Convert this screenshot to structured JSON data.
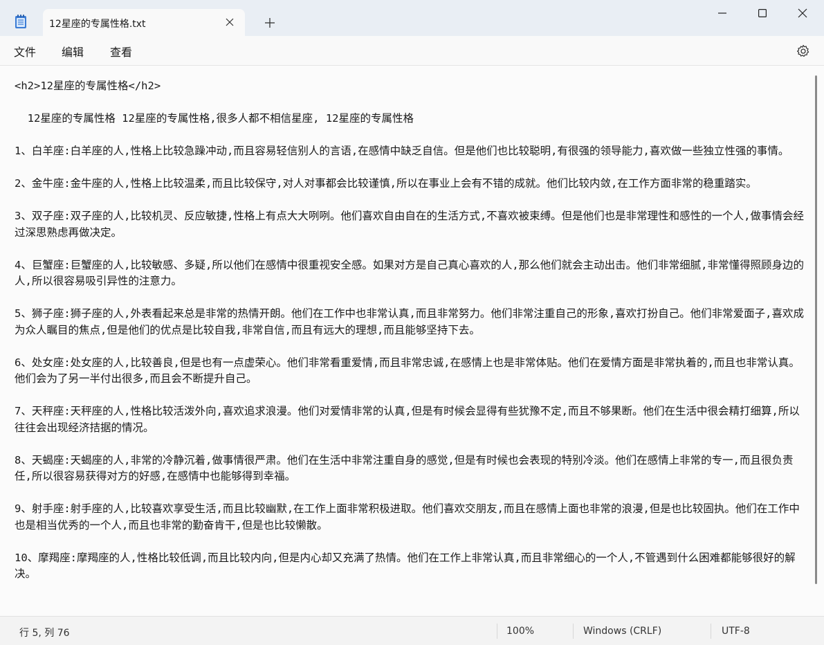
{
  "window": {
    "tab_title": "12星座的专属性格.txt",
    "new_tab_symbol": "+",
    "close_tab_symbol": "✕",
    "minimize_symbol": "─",
    "maximize_symbol": "☐",
    "close_symbol": "✕"
  },
  "menu": {
    "file": "文件",
    "edit": "编辑",
    "view": "查看"
  },
  "icons": {
    "app": "notepad-icon",
    "settings": "gear-icon"
  },
  "document": {
    "text": "<h2>12星座的专属性格</h2>\n\n  12星座的专属性格 12星座的专属性格,很多人都不相信星座, 12星座的专属性格\n\n1、白羊座:白羊座的人,性格上比较急躁冲动,而且容易轻信别人的言语,在感情中缺乏自信。但是他们也比较聪明,有很强的领导能力,喜欢做一些独立性强的事情。\n\n2、金牛座:金牛座的人,性格上比较温柔,而且比较保守,对人对事都会比较谨慎,所以在事业上会有不错的成就。他们比较内敛,在工作方面非常的稳重踏实。\n\n3、双子座:双子座的人,比较机灵、反应敏捷,性格上有点大大咧咧。他们喜欢自由自在的生活方式,不喜欢被束缚。但是他们也是非常理性和感性的一个人,做事情会经过深思熟虑再做决定。\n\n4、巨蟹座:巨蟹座的人,比较敏感、多疑,所以他们在感情中很重视安全感。如果对方是自己真心喜欢的人,那么他们就会主动出击。他们非常细腻,非常懂得照顾身边的人,所以很容易吸引异性的注意力。\n\n5、狮子座:狮子座的人,外表看起来总是非常的热情开朗。他们在工作中也非常认真,而且非常努力。他们非常注重自己的形象,喜欢打扮自己。他们非常爱面子,喜欢成为众人瞩目的焦点,但是他们的优点是比较自我,非常自信,而且有远大的理想,而且能够坚持下去。\n\n6、处女座:处女座的人,比较善良,但是也有一点虚荣心。他们非常看重爱情,而且非常忠诚,在感情上也是非常体贴。他们在爱情方面是非常执着的,而且也非常认真。他们会为了另一半付出很多,而且会不断提升自己。\n\n7、天秤座:天秤座的人,性格比较活泼外向,喜欢追求浪漫。他们对爱情非常的认真,但是有时候会显得有些犹豫不定,而且不够果断。他们在生活中很会精打细算,所以往往会出现经济拮据的情况。\n\n8、天蝎座:天蝎座的人,非常的冷静沉着,做事情很严肃。他们在生活中非常注重自身的感觉,但是有时候也会表现的特别冷淡。他们在感情上非常的专一,而且很负责任,所以很容易获得对方的好感,在感情中也能够得到幸福。\n\n9、射手座:射手座的人,比较喜欢享受生活,而且比较幽默,在工作上面非常积极进取。他们喜欢交朋友,而且在感情上面也非常的浪漫,但是也比较固执。他们在工作中也是相当优秀的一个人,而且也非常的勤奋肯干,但是也比较懒散。\n\n10、摩羯座:摩羯座的人,性格比较低调,而且比较内向,但是内心却又充满了热情。他们在工作上非常认真,而且非常细心的一个人,不管遇到什么困难都能够很好的解决。"
  },
  "status": {
    "position": "行 5, 列 76",
    "zoom": "100%",
    "line_ending": "Windows (CRLF)",
    "encoding": "UTF-8"
  }
}
